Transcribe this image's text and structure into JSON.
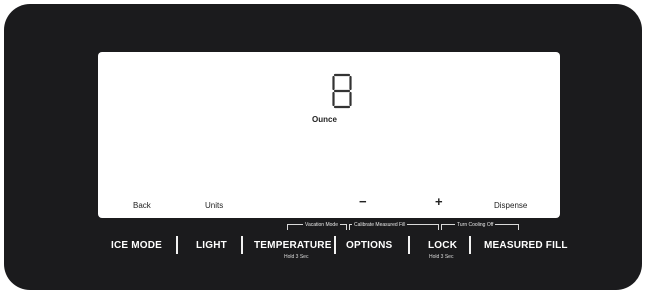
{
  "display": {
    "digit": "8",
    "unit": "Ounce"
  },
  "soft_keys": [
    {
      "label": "Back"
    },
    {
      "label": "Units"
    },
    {
      "label": "−"
    },
    {
      "label": "+"
    },
    {
      "label": "Dispense"
    }
  ],
  "modes": {
    "vacation": "Vacation Mode",
    "calibrate": "Calibrate Measured Fill",
    "cooling_off": "Turn Cooling Off"
  },
  "buttons": [
    {
      "label": "ICE MODE",
      "hold": ""
    },
    {
      "label": "LIGHT",
      "hold": ""
    },
    {
      "label": "TEMPERATURE",
      "hold": "Hold 3 Sec"
    },
    {
      "label": "OPTIONS",
      "hold": ""
    },
    {
      "label": "LOCK",
      "hold": "Hold 3 Sec"
    },
    {
      "label": "MEASURED FILL",
      "hold": ""
    }
  ],
  "colors": {
    "panel": "#1b1b1d",
    "screen": "#ffffff",
    "digit": "#333333"
  }
}
